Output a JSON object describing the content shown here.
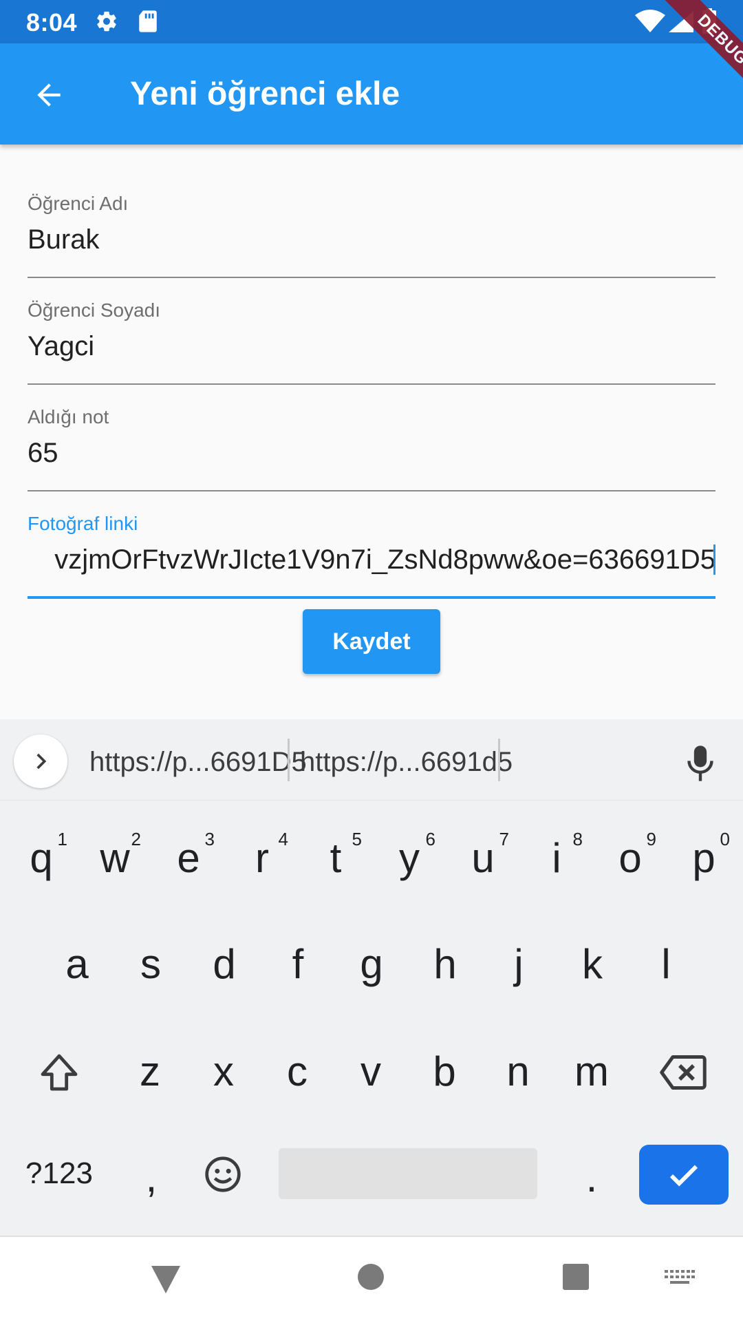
{
  "status_bar": {
    "time": "8:04",
    "icons": [
      "gear-icon",
      "sd-card-icon",
      "wifi-icon",
      "signal-icon",
      "battery-icon"
    ]
  },
  "debug_banner": "DEBUG",
  "app_bar": {
    "back_icon": "arrow-back-icon",
    "title": "Yeni öğrenci ekle",
    "color": "#2196f3"
  },
  "form": {
    "first_name": {
      "label": "Öğrenci Adı",
      "value": "Burak"
    },
    "last_name": {
      "label": "Öğrenci Soyadı",
      "value": "Yagci"
    },
    "grade": {
      "label": "Aldığı not",
      "value": "65"
    },
    "photo_link": {
      "label": "Fotoğraf linki",
      "value": "vzjmOrFtvzWrJIcte1V9n7i_ZsNd8pww&oe=636691D5"
    },
    "save_label": "Kaydet"
  },
  "keyboard": {
    "suggestions": [
      "https://p...6691D5",
      "https://p...6691d5"
    ],
    "row1": [
      "q",
      "w",
      "e",
      "r",
      "t",
      "y",
      "u",
      "i",
      "o",
      "p"
    ],
    "row1_hints": [
      "1",
      "2",
      "3",
      "4",
      "5",
      "6",
      "7",
      "8",
      "9",
      "0"
    ],
    "row2": [
      "a",
      "s",
      "d",
      "f",
      "g",
      "h",
      "j",
      "k",
      "l"
    ],
    "row3": [
      "z",
      "x",
      "c",
      "v",
      "b",
      "n",
      "m"
    ],
    "symbols_label": "?123",
    "comma": ",",
    "period": ".",
    "enter_color": "#1a73e8"
  },
  "nav_bar": {
    "icons": [
      "back-triangle-icon",
      "home-circle-icon",
      "recents-square-icon",
      "keyboard-switch-icon"
    ]
  }
}
